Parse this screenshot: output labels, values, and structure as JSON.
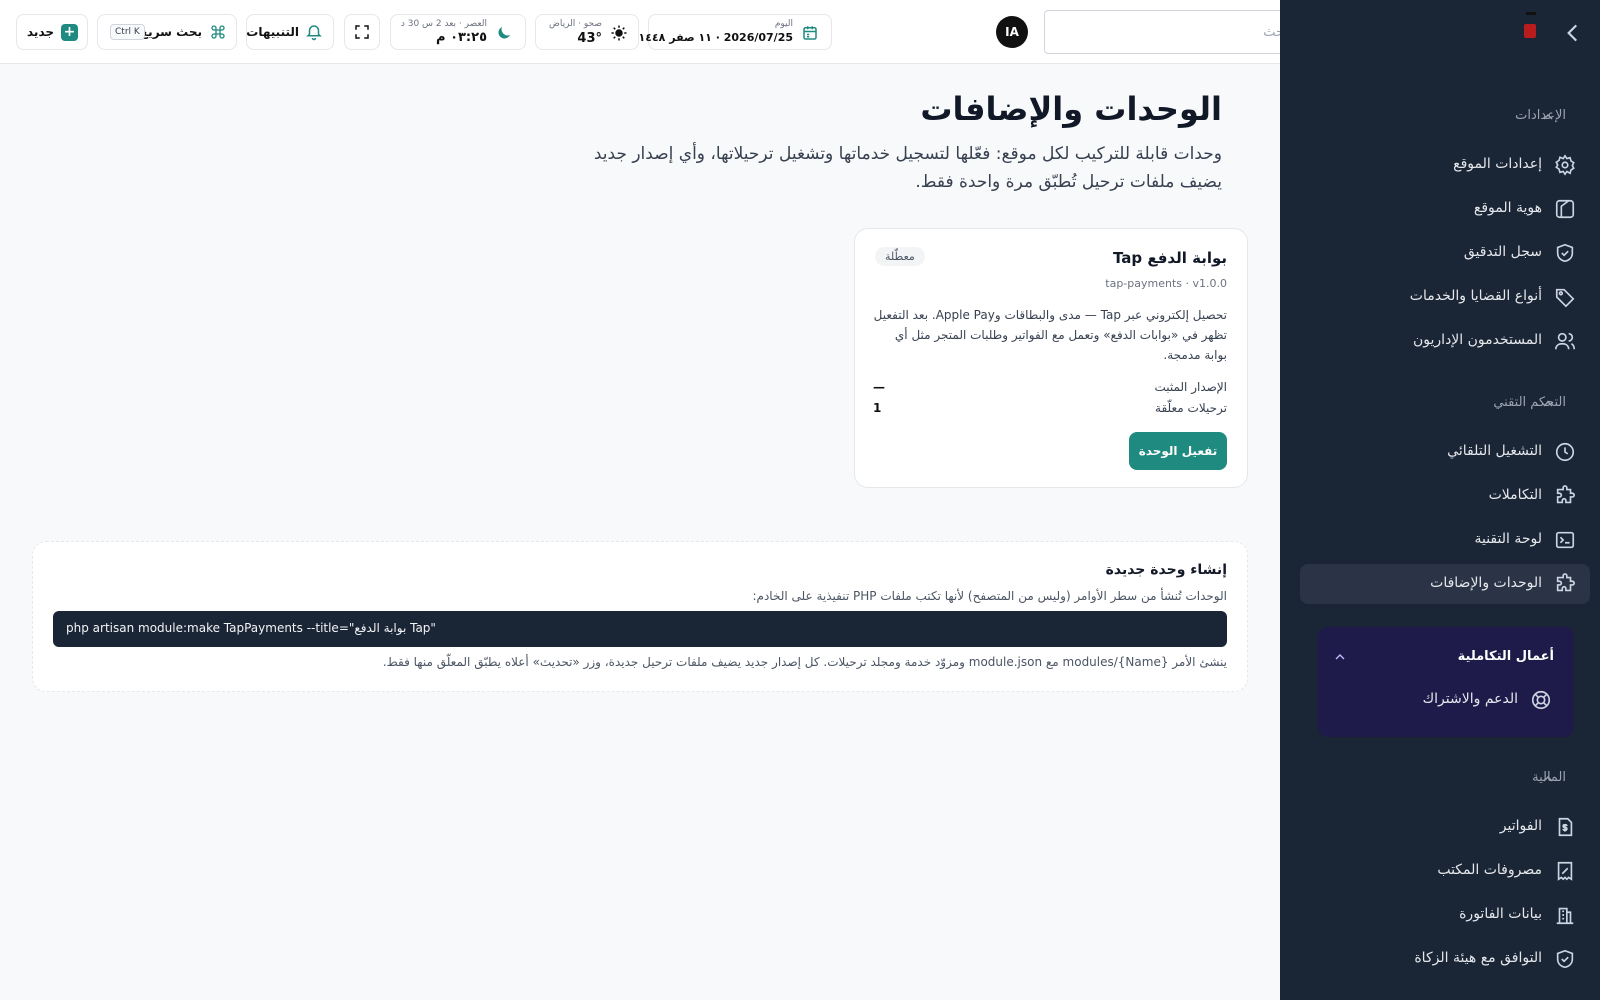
{
  "header": {
    "search_placeholder": "بحث",
    "avatar_initials": "IA",
    "date": {
      "label": "اليوم",
      "value": "2026/07/25 · ١١ صفر ١٤٤٨ هـ"
    },
    "weather": {
      "label": "صحو · الرياض",
      "value": "43°"
    },
    "prayer": {
      "label": "العصر · بعد 2 س 30 د",
      "value": "٠٣:٢٥ م"
    },
    "notifications_label": "التنبيهات",
    "quick_search_label": "بحث سريع",
    "quick_search_shortcut": "Ctrl K",
    "new_label": "جديد"
  },
  "sidebar": {
    "sections": [
      {
        "title": "الإعدادات",
        "items": [
          {
            "label": "إعدادات الموقع",
            "icon": "gear-icon"
          },
          {
            "label": "هوية الموقع",
            "icon": "brush-icon"
          },
          {
            "label": "سجل التدقيق",
            "icon": "shield-check-icon"
          },
          {
            "label": "أنواع القضايا والخدمات",
            "icon": "tag-icon"
          },
          {
            "label": "المستخدمون الإداريون",
            "icon": "users-icon"
          }
        ]
      },
      {
        "title": "التحكم التقني",
        "items": [
          {
            "label": "التشغيل التلقائي",
            "icon": "clock-icon"
          },
          {
            "label": "التكاملات",
            "icon": "puzzle-icon"
          },
          {
            "label": "لوحة التقنية",
            "icon": "terminal-icon"
          },
          {
            "label": "الوحدات والإضافات",
            "icon": "puzzle-icon",
            "active": true
          }
        ]
      },
      {
        "title": "أعمال التكاملية",
        "items": [
          {
            "label": "الدعم والاشتراك",
            "icon": "lifebuoy-icon"
          }
        ]
      },
      {
        "title": "المالية",
        "items": [
          {
            "label": "الفواتير",
            "icon": "invoice-icon"
          },
          {
            "label": "مصروفات المكتب",
            "icon": "receipt-icon"
          },
          {
            "label": "بيانات الفاتورة",
            "icon": "building-icon"
          },
          {
            "label": "التوافق مع هيئة الزكاة",
            "icon": "shield-check-icon"
          }
        ]
      }
    ]
  },
  "main": {
    "title": "الوحدات والإضافات",
    "subtitle": "وحدات قابلة للتركيب لكل موقع: فعّلها لتسجيل خدماتها وتشغيل ترحيلاتها، وأي إصدار جديد يضيف ملفات ترحيل تُطبّق مرة واحدة فقط.",
    "module_card": {
      "title": "بوابة الدفع Tap",
      "status": "معطّلة",
      "meta": "tap-payments · v1.0.0",
      "description": "تحصيل إلكتروني عبر Tap — مدى والبطاقات وApple Pay. بعد التفعيل تظهر في «بوابات الدفع» وتعمل مع الفواتير وطلبات المتجر مثل أي بوابة مدمجة.",
      "installed_version_label": "الإصدار المثبت",
      "installed_version_value": "—",
      "pending_migrations_label": "ترحيلات معلّقة",
      "pending_migrations_value": "1",
      "activate_label": "تفعيل الوحدة"
    },
    "create_module": {
      "title": "إنشاء وحدة جديدة",
      "description": "الوحدات تُنشأ من سطر الأوامر (وليس من المتصفح) لأنها تكتب ملفات PHP تنفيذية على الخادم:",
      "command": "php artisan module:make TapPayments --title=\"بوابة الدفع Tap\"",
      "note": "ينشئ الأمر modules/{Name} مع module.json ومزوّد خدمة ومجلد ترحيلات. كل إصدار جديد يضيف ملفات ترحيل جديدة، وزر «تحديث» أعلاه يطبّق المعلّق منها فقط."
    }
  },
  "colors": {
    "accent": "#1f8a7f",
    "sidebar_bg": "#1a2535",
    "purple_panel": "#1e1b4b"
  }
}
